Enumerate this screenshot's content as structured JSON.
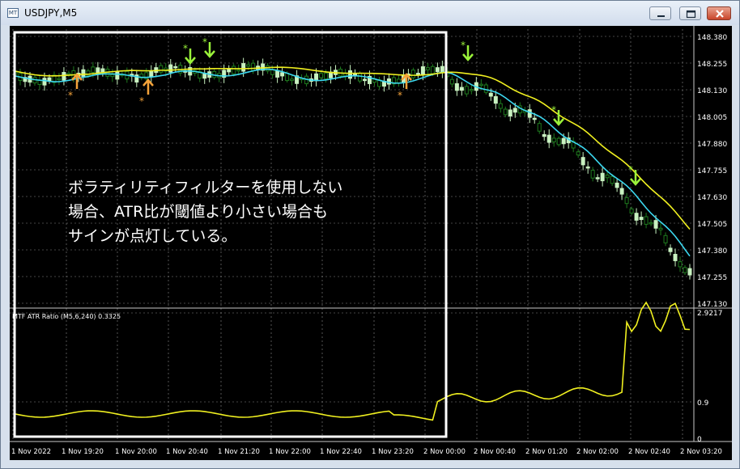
{
  "window": {
    "title": "USDJPY,M5",
    "app_icon_text": "MT"
  },
  "price_axis": [
    "148.380",
    "148.255",
    "148.130",
    "148.005",
    "147.880",
    "147.755",
    "147.630",
    "147.505",
    "147.380",
    "147.255",
    "147.130"
  ],
  "indicator": {
    "label": "MTF ATR Ratio  (M5,6,240) 0.3325",
    "axis_top": "2.9217",
    "axis_mid": "0.9",
    "axis_bottom": "0"
  },
  "time_axis": [
    "1 Nov 2022",
    "1 Nov 19:20",
    "1 Nov 20:00",
    "1 Nov 20:40",
    "1 Nov 21:20",
    "1 Nov 22:00",
    "1 Nov 22:40",
    "1 Nov 23:20",
    "2 Nov 00:00",
    "2 Nov 00:40",
    "2 Nov 01:20",
    "2 Nov 02:00",
    "2 Nov 02:40",
    "2 Nov 03:20"
  ],
  "annotation": {
    "line1": "ボラティリティフィルターを使用しない",
    "line2": "場合、ATR比が閾値より小さい場合も",
    "line3": "サインが点灯している。"
  },
  "colors": {
    "background": "#000000",
    "bull_candle": "#c8f2c0",
    "bear_candle": "#1e7a1e",
    "ma_fast": "#3cd8f0",
    "ma_slow": "#f0f020",
    "atr_line": "#f0f020",
    "arrow_sell": "#9af23a",
    "arrow_buy": "#f5a33a",
    "highlight_box": "#ffffff"
  },
  "icons": [
    "minimize-icon",
    "maximize-icon",
    "close-icon",
    "sell-arrow-icon",
    "buy-arrow-icon"
  ]
}
